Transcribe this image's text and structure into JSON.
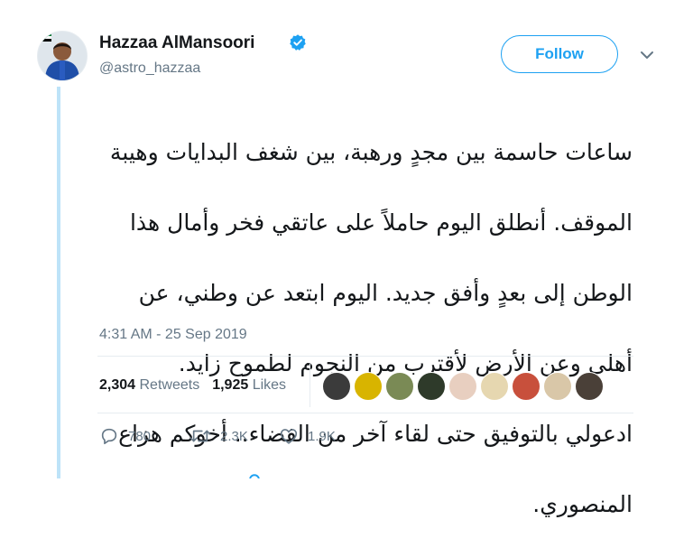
{
  "user": {
    "display_name": "Hazzaa AlMansoori",
    "handle": "@astro_hazzaa",
    "verified": true
  },
  "follow_label": "Follow",
  "tweet": {
    "text_lines": [
      "ساعات حاسمة بين مجدٍ ورهبة، بين شغف البدايات وهيبة",
      "الموقف. أنطلق اليوم حاملاً على عاتقي فخر وأمال هذا",
      "الوطن إلى بعدٍ وأفق جديد. اليوم ابتعد عن وطني، عن",
      "أهلي وعن الأرض لأقترب من النجوم  لطموح زايد.",
      "ادعولي بالتوفيق حتى لقاء آخر من الفضاء.. أخوكم هزاع",
      "المنصوري."
    ],
    "timestamp": "4:31 AM - 25 Sep 2019"
  },
  "stats": {
    "retweets_count": "2,304",
    "retweets_label": "Retweets",
    "likes_count": "1,925",
    "likes_label": "Likes"
  },
  "liker_avatar_colors": [
    "#3b3b3b",
    "#d8b400",
    "#7a8a55",
    "#2e3a2a",
    "#e8cfc0",
    "#e6d7b0",
    "#c8503c",
    "#d9c7a8",
    "#4a4038"
  ],
  "actions": {
    "reply_count": "780",
    "retweet_count": "2.3K",
    "like_count": "1.9K"
  },
  "colors": {
    "accent": "#1da1f2",
    "secondary_text": "#657786",
    "thread_line": "#bde3f8"
  }
}
